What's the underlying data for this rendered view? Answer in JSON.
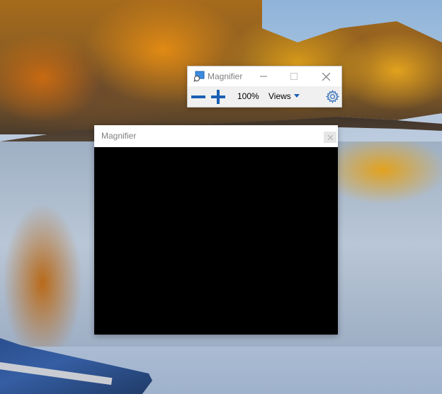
{
  "toolbar": {
    "title": "Magnifier",
    "zoom_level": "100%",
    "views_label": "Views",
    "minimize_icon": "minimize-icon",
    "maximize_icon": "maximize-icon",
    "close_icon": "close-icon",
    "zoom_out_icon": "zoom-out-icon",
    "zoom_in_icon": "zoom-in-icon",
    "settings_icon": "gear-icon",
    "accent_color": "#1a5fb4"
  },
  "lens": {
    "title": "Magnifier",
    "close_icon": "close-icon",
    "view_color": "#000000"
  }
}
